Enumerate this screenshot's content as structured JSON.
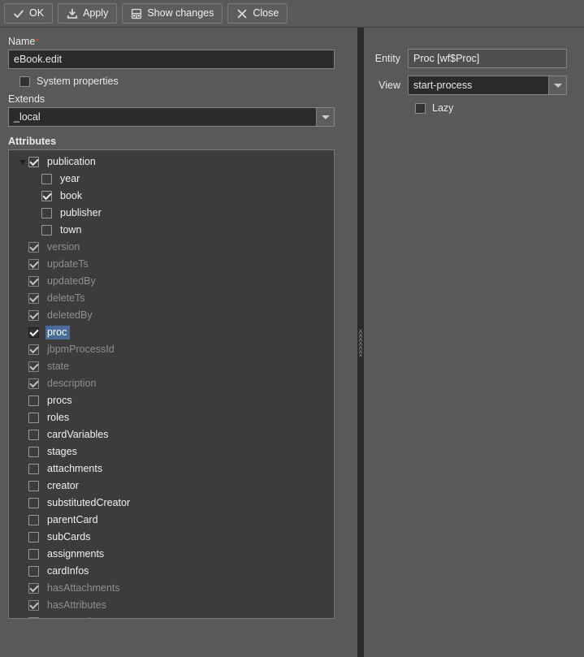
{
  "toolbar": {
    "buttons": [
      {
        "label": "OK",
        "icon": "check-icon",
        "name": "ok-button"
      },
      {
        "label": "Apply",
        "icon": "save-icon",
        "name": "apply-button"
      },
      {
        "label": "Show changes",
        "icon": "diff-icon",
        "name": "show-changes-button"
      },
      {
        "label": "Close",
        "icon": "close-x-icon",
        "name": "close-button"
      }
    ]
  },
  "left": {
    "name_label": "Name",
    "name_required_marker": "*",
    "name_value": "eBook.edit",
    "system_properties_label": "System properties",
    "system_properties_checked": false,
    "extends_label": "Extends",
    "extends_value": "_local",
    "attributes_label": "Attributes"
  },
  "right": {
    "entity_label": "Entity",
    "entity_value": "Proc [wf$Proc]",
    "view_label": "View",
    "view_value": "start-process",
    "lazy_label": "Lazy",
    "lazy_checked": false
  },
  "colors": {
    "window_background": "#595959",
    "tree_background": "#3c3c3c",
    "input_background": "#2b2b2b",
    "selection_blue": "#4a6c9b",
    "required_red": "#e2443a",
    "disabled_text": "#8f8f8f",
    "enabled_text": "#f0f0f0"
  },
  "attributes": [
    {
      "label": "publication",
      "level": 0,
      "checked": true,
      "disabled": false,
      "selected": false,
      "expanded": true
    },
    {
      "label": "year",
      "level": 1,
      "checked": false,
      "disabled": false,
      "selected": false
    },
    {
      "label": "book",
      "level": 1,
      "checked": true,
      "disabled": false,
      "selected": false
    },
    {
      "label": "publisher",
      "level": 1,
      "checked": false,
      "disabled": false,
      "selected": false
    },
    {
      "label": "town",
      "level": 1,
      "checked": false,
      "disabled": false,
      "selected": false
    },
    {
      "label": "version",
      "level": 0,
      "checked": true,
      "disabled": true,
      "selected": false
    },
    {
      "label": "updateTs",
      "level": 0,
      "checked": true,
      "disabled": true,
      "selected": false
    },
    {
      "label": "updatedBy",
      "level": 0,
      "checked": true,
      "disabled": true,
      "selected": false
    },
    {
      "label": "deleteTs",
      "level": 0,
      "checked": true,
      "disabled": true,
      "selected": false
    },
    {
      "label": "deletedBy",
      "level": 0,
      "checked": true,
      "disabled": true,
      "selected": false
    },
    {
      "label": "proc",
      "level": 0,
      "checked": true,
      "disabled": false,
      "selected": true
    },
    {
      "label": "jbpmProcessId",
      "level": 0,
      "checked": true,
      "disabled": true,
      "selected": false
    },
    {
      "label": "state",
      "level": 0,
      "checked": true,
      "disabled": true,
      "selected": false
    },
    {
      "label": "description",
      "level": 0,
      "checked": true,
      "disabled": true,
      "selected": false
    },
    {
      "label": "procs",
      "level": 0,
      "checked": false,
      "disabled": false,
      "selected": false
    },
    {
      "label": "roles",
      "level": 0,
      "checked": false,
      "disabled": false,
      "selected": false
    },
    {
      "label": "cardVariables",
      "level": 0,
      "checked": false,
      "disabled": false,
      "selected": false
    },
    {
      "label": "stages",
      "level": 0,
      "checked": false,
      "disabled": false,
      "selected": false
    },
    {
      "label": "attachments",
      "level": 0,
      "checked": false,
      "disabled": false,
      "selected": false
    },
    {
      "label": "creator",
      "level": 0,
      "checked": false,
      "disabled": false,
      "selected": false
    },
    {
      "label": "substitutedCreator",
      "level": 0,
      "checked": false,
      "disabled": false,
      "selected": false
    },
    {
      "label": "parentCard",
      "level": 0,
      "checked": false,
      "disabled": false,
      "selected": false
    },
    {
      "label": "subCards",
      "level": 0,
      "checked": false,
      "disabled": false,
      "selected": false
    },
    {
      "label": "assignments",
      "level": 0,
      "checked": false,
      "disabled": false,
      "selected": false
    },
    {
      "label": "cardInfos",
      "level": 0,
      "checked": false,
      "disabled": false,
      "selected": false
    },
    {
      "label": "hasAttachments",
      "level": 0,
      "checked": true,
      "disabled": true,
      "selected": false
    },
    {
      "label": "hasAttributes",
      "level": 0,
      "checked": true,
      "disabled": true,
      "selected": false
    },
    {
      "label": "procFamily",
      "level": 0,
      "checked": true,
      "disabled": true,
      "selected": false
    }
  ]
}
